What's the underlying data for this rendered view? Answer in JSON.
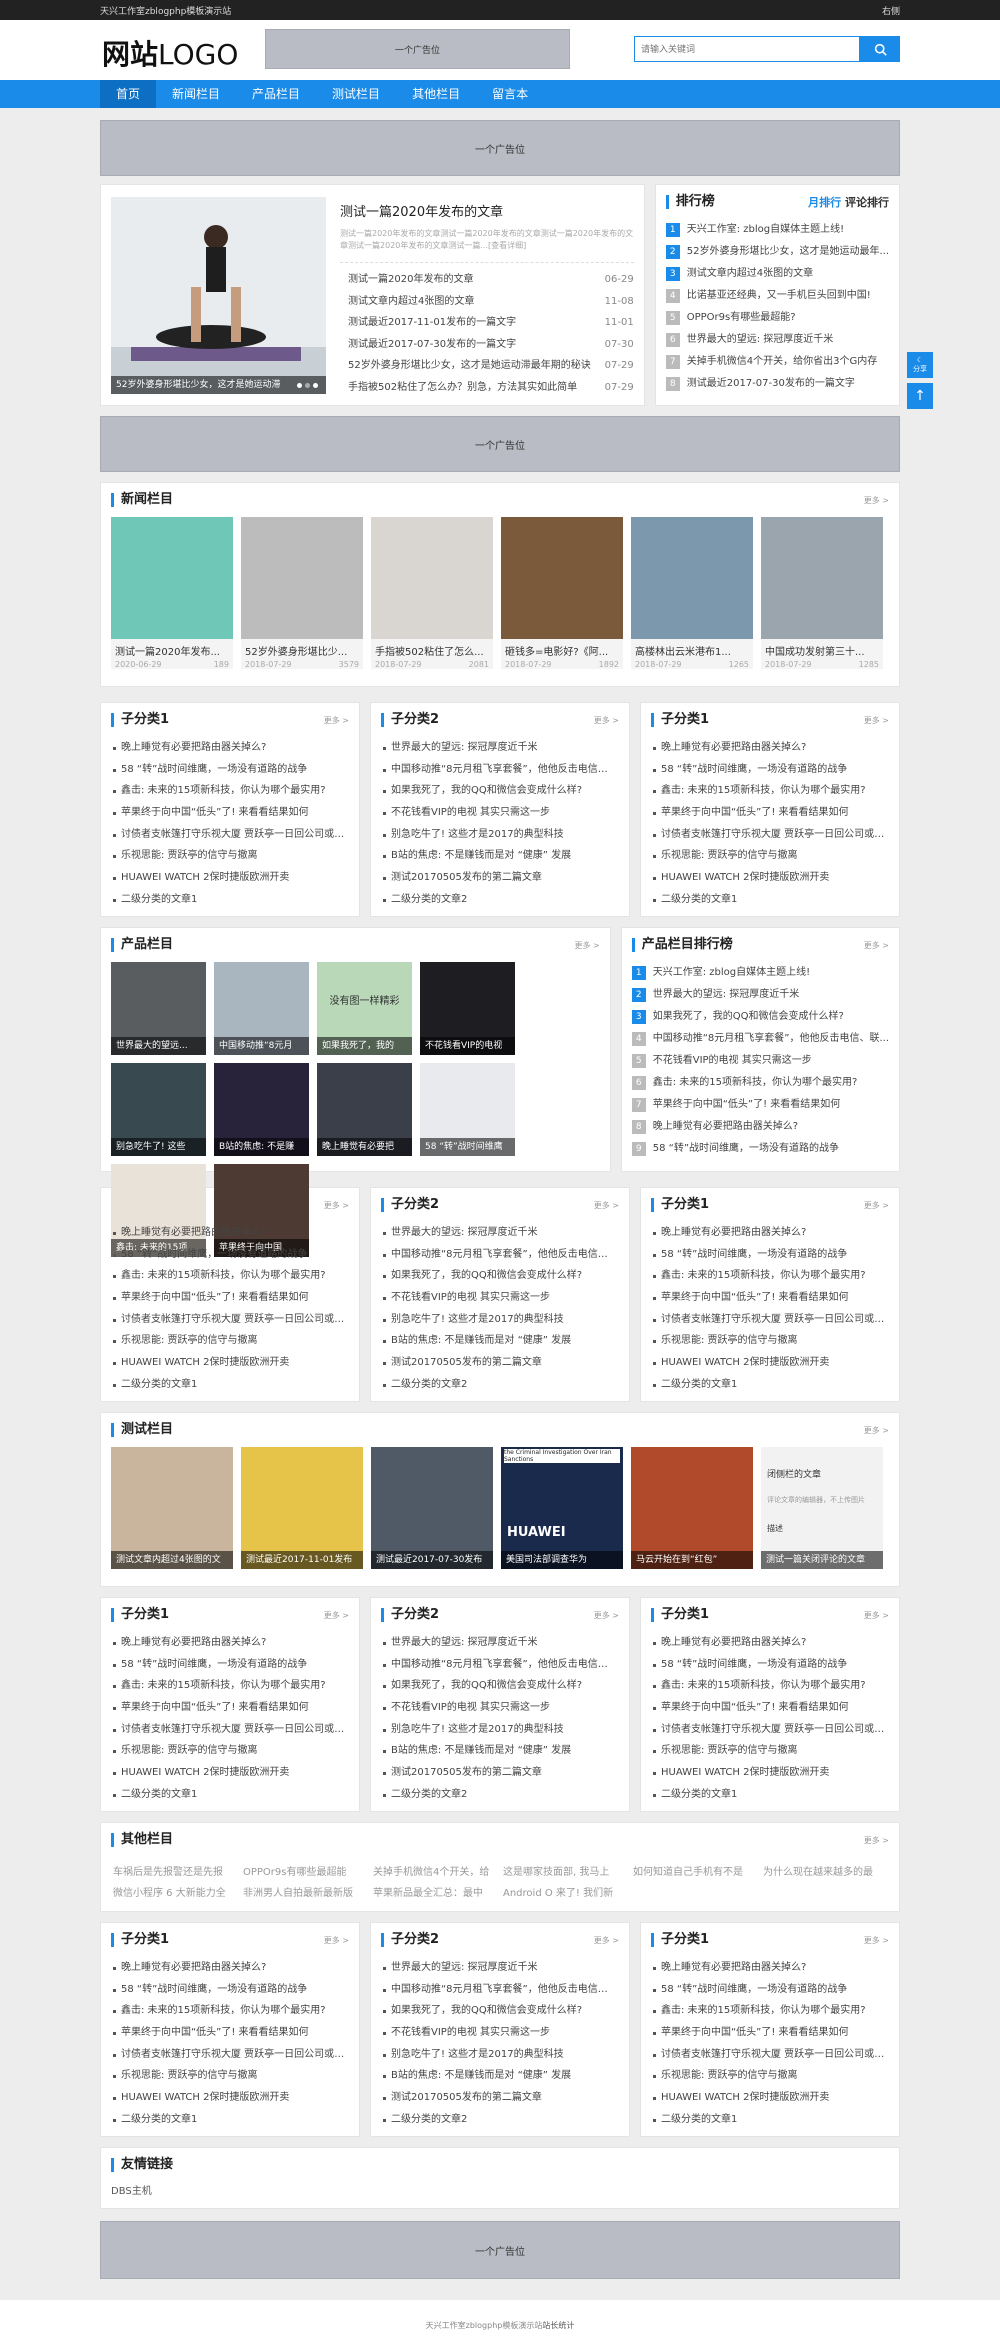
{
  "topbar": {
    "title": "天兴工作室zblogphp模板演示站",
    "right": "右侧"
  },
  "header": {
    "logo_bold": "网站",
    "logo_text": "LOGO",
    "ad": "一个广告位",
    "search_placeholder": "请输入关键词"
  },
  "nav": [
    "首页",
    "新闻栏目",
    "产品栏目",
    "测试栏目",
    "其他栏目",
    "留言本"
  ],
  "ads": {
    "ad1": "一个广告位",
    "ad2": "一个广告位",
    "ad3": "一个广告位"
  },
  "featured": {
    "slide_caption": "52岁外婆身形堪比少女，这才是她运动滞",
    "title": "测试一篇2020年发布的文章",
    "desc": "测试一篇2020年发布的文章测试一篇2020年发布的文章测试一篇2020年发布的文章测试一篇2020年发布的文章测试一篇...[查看详细]",
    "list": [
      {
        "t": "测试一篇2020年发布的文章",
        "d": "06-29"
      },
      {
        "t": "测试文章内超过4张图的文章",
        "d": "11-08"
      },
      {
        "t": "测试最近2017-11-01发布的一篇文字",
        "d": "11-01"
      },
      {
        "t": "测试最近2017-07-30发布的一篇文字",
        "d": "07-30"
      },
      {
        "t": "52岁外婆身形堪比少女，这才是她运动滞最年期的秘诀",
        "d": "07-29"
      },
      {
        "t": "手指被502粘住了怎么办？别急，方法其实如此简单",
        "d": "07-29"
      }
    ]
  },
  "ranking": {
    "title": "排行榜",
    "tab1": "月排行",
    "tab2": "评论排行",
    "items": [
      "天兴工作室: zblog自媒体主题上线!",
      "52岁外婆身形堪比少女，这才是她运动最年...",
      "测试文章内超过4张图的文章",
      "比诺基亚还经典，又一手机巨头回到中国!",
      "OPPOr9s有哪些最超能?",
      "世界最大的望远: 探冠厚度近千米",
      "关掉手机微信4个开关，给你省出3个G内存",
      "测试最近2017-07-30发布的一篇文字"
    ]
  },
  "news": {
    "title": "新闻栏目",
    "more": "更多 >",
    "items": [
      {
        "t": "测试一篇2020年发布...",
        "d": "2020-06-29",
        "v": "189"
      },
      {
        "t": "52岁外婆身形堪比少...",
        "d": "2018-07-29",
        "v": "3579"
      },
      {
        "t": "手指被502粘住了怎么...",
        "d": "2018-07-29",
        "v": "2081"
      },
      {
        "t": "砸钱多=电影好?《阿...",
        "d": "2018-07-29",
        "v": "1892"
      },
      {
        "t": "高楼林出云米港布1...",
        "d": "2018-07-29",
        "v": "1265"
      },
      {
        "t": "中国成功发射第三十...",
        "d": "2018-07-29",
        "v": "1285"
      }
    ]
  },
  "sub_a": [
    "晚上睡觉有必要把路由器关掉么?",
    "58 “转”战时间维鹰，一场没有道路的战争",
    "鑫击: 未来的15项新科技，你认为哪个最实用?",
    "苹果终于向中国“低头”了! 来看看结果如何",
    "讨债者支帐篷打守乐视大厦 贾跃亭一日回公司或被跟身",
    "乐视思能: 贾跃亭的信守与撤离",
    "HUAWEI WATCH 2保时捷版欧洲开卖",
    "二级分类的文章1"
  ],
  "sub_b": [
    "世界最大的望远: 探冠厚度近千米",
    "中国移动推“8元月租飞享套餐”，他他反击电信、联...",
    "如果我死了，我的QQ和微信会变成什么样?",
    "不花钱看VIP的电视 其实只需这一步",
    "别急吃牛了! 这些才是2017的典型科技",
    "B站的焦虑: 不是赚钱而是对 “健康” 发展",
    "测试20170505发布的第二篇文章",
    "二级分类的文章2"
  ],
  "labels": {
    "sub1": "子分类1",
    "sub2": "子分类2",
    "more": "更多 >"
  },
  "products": {
    "title": "产品栏目",
    "more": "更多 >",
    "items": [
      "世界最大的望远...",
      "中国移动推“8元月",
      "如果我死了，我的",
      "不花钱看VIP的电视",
      "别急吃牛了! 这些",
      "B站的焦虑: 不是赚",
      "晚上睡觉有必要把",
      "58 “转”战时间维鹰",
      "鑫击: 未来的15项",
      "苹果终于向中国"
    ],
    "text_img": "没有图一样精彩"
  },
  "prod_rank": {
    "title": "产品栏目排行榜",
    "more": "更多 >",
    "items": [
      "天兴工作室: zblog自媒体主题上线!",
      "世界最大的望远: 探冠厚度近千米",
      "如果我死了，我的QQ和微信会变成什么样?",
      "中国移动推“8元月租飞享套餐”，他他反击电信、联...",
      "不花钱看VIP的电视 其实只需这一步",
      "鑫击: 未来的15项新科技，你认为哪个最实用?",
      "苹果终于向中国“低头”了! 来看看结果如何",
      "晚上睡觉有必要把路由器关掉么?",
      "58 “转”战时间维鹰，一场没有道路的战争"
    ]
  },
  "tests": {
    "title": "测试栏目",
    "more": "更多 >",
    "items": [
      "测试文章内超过4张图的文",
      "测试最近2017-11-01发布",
      "测试最近2017-07-30发布",
      "美国司法部调查华为",
      "马云开始在到“红包”",
      "测试一篇关闭评论的文章"
    ],
    "comment_title": "闭侧栏的文章",
    "comment_hint": "评论文章的编辑器，不上传图片",
    "newspaper_head": "the Criminal Investigation Over Iran Sanctions",
    "huawei": "HUAWEI",
    "label_a": "描述"
  },
  "other": {
    "title": "其他栏目",
    "more": "更多 >",
    "tags": [
      "车祸后是先报警还是先报",
      "OPPOr9s有哪些最超能",
      "关掉手机微信4个开关，给",
      "这是哪家技面部, 我马上",
      "如何知道自己手机有不是",
      "为什么现在越来越多的最",
      "微信小程序 6 大新能力全",
      "非洲男人自拍最新最新版",
      "苹果新品最全汇总：最中",
      "Android O 来了! 我们新"
    ]
  },
  "links": {
    "title": "友情链接",
    "items": [
      "DBS主机"
    ]
  },
  "footer": {
    "text": "天兴工作室zblogphp模板演示站",
    "link": "站长统计"
  },
  "side": {
    "moon": "☾",
    "share": "分享",
    "top": "↑"
  },
  "colors": {
    "accent": "#1a8be8",
    "nav_active": "#0c6fc4",
    "ad_bg": "#b9bcc4"
  }
}
